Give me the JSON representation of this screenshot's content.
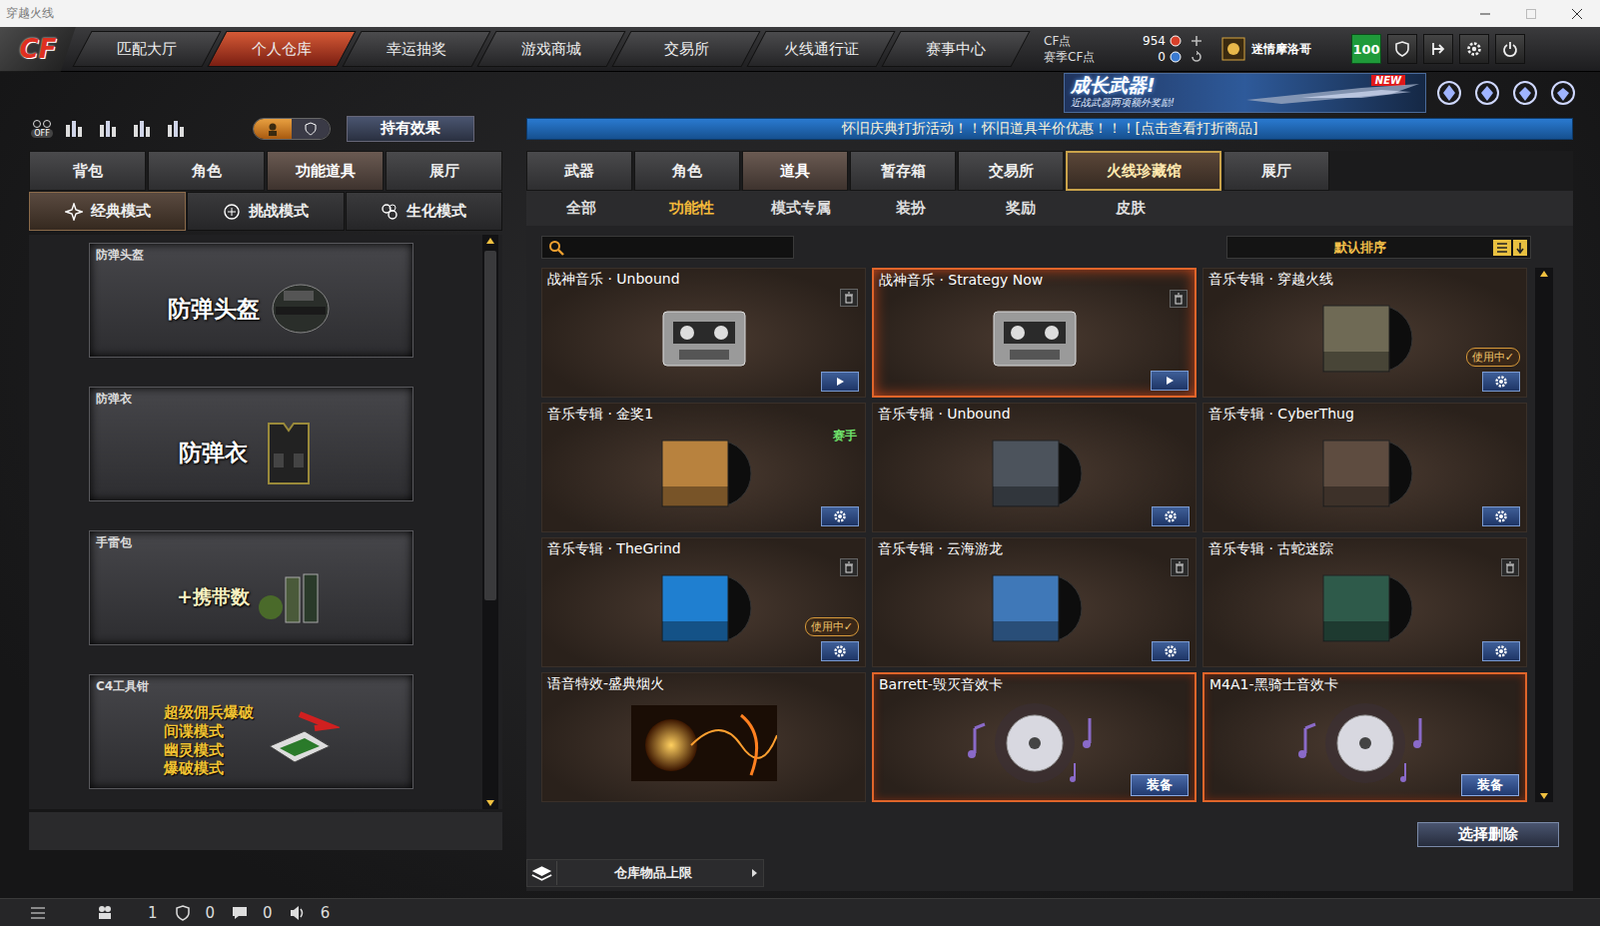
{
  "window": {
    "title": "穿越火线"
  },
  "nav": {
    "logo": "CF",
    "tabs": [
      {
        "label": "匹配大厅",
        "selected": false
      },
      {
        "label": "个人仓库",
        "selected": true
      },
      {
        "label": "幸运抽奖",
        "selected": false
      },
      {
        "label": "游戏商城",
        "selected": false
      },
      {
        "label": "交易所",
        "selected": false
      },
      {
        "label": "火线通行证",
        "selected": false
      },
      {
        "label": "赛事中心",
        "selected": false
      }
    ],
    "currency": [
      {
        "label": "CF点",
        "value": "954"
      },
      {
        "label": "赛季CF点",
        "value": "0"
      }
    ],
    "user": {
      "name": "迷情摩洛哥",
      "level": "100"
    }
  },
  "banner": {
    "title": "成长武器!",
    "subtitle": "近战武器两项额外奖励!",
    "badge": "NEW"
  },
  "announcement": "怀旧庆典打折活动！！怀旧道具半价优惠！！！[点击查看打折商品]",
  "left": {
    "toolbar": {
      "off_label": "OFF",
      "view_toggle": [
        {
          "selected": true
        },
        {
          "selected": false
        }
      ],
      "effect_button": "持有效果"
    },
    "tabs": [
      {
        "label": "背包",
        "selected": false
      },
      {
        "label": "角色",
        "selected": false
      },
      {
        "label": "功能道具",
        "selected": true
      },
      {
        "label": "展厅",
        "selected": false
      }
    ],
    "modes": [
      {
        "label": "经典模式",
        "selected": true
      },
      {
        "label": "挑战模式",
        "selected": false
      },
      {
        "label": "生化模式",
        "selected": false
      }
    ],
    "items": [
      {
        "label": "防弹头盔",
        "kind": "helmet",
        "captions": [
          "防弹头盔"
        ]
      },
      {
        "label": "防弹衣",
        "kind": "vest",
        "captions": [
          "防弹衣"
        ]
      },
      {
        "label": "手雷包",
        "kind": "grenade",
        "captions": [
          "+携带数"
        ]
      },
      {
        "label": "C4工具钳",
        "kind": "c4",
        "captions": [
          "超级佣兵爆破",
          "间谍模式",
          "幽灵模式",
          "爆破模式"
        ]
      }
    ]
  },
  "right": {
    "tabs": [
      {
        "label": "武器",
        "selected": false,
        "featured": false
      },
      {
        "label": "角色",
        "selected": false,
        "featured": false
      },
      {
        "label": "道具",
        "selected": true,
        "featured": false
      },
      {
        "label": "暂存箱",
        "selected": false,
        "featured": false
      },
      {
        "label": "交易所",
        "selected": false,
        "featured": false
      },
      {
        "label": "火线珍藏馆",
        "selected": false,
        "featured": true
      },
      {
        "label": "展厅",
        "selected": false,
        "featured": false
      }
    ],
    "subtabs": [
      {
        "label": "全部",
        "selected": false
      },
      {
        "label": "功能性",
        "selected": true
      },
      {
        "label": "模式专属",
        "selected": false
      },
      {
        "label": "装扮",
        "selected": false
      },
      {
        "label": "奖励",
        "selected": false
      },
      {
        "label": "皮肤",
        "selected": false
      }
    ],
    "search": {
      "value": ""
    },
    "sort": "默认排序",
    "items": [
      {
        "title": "战神音乐 · Unbound",
        "kind": "cassette",
        "selected": false,
        "highlighted": false,
        "deletable": true,
        "playable": true,
        "settings": false
      },
      {
        "title": "战神音乐 · Strategy Now",
        "kind": "cassette",
        "selected": true,
        "highlighted": true,
        "deletable": true,
        "playable": true,
        "settings": false
      },
      {
        "title": "音乐专辑 · 穿越火线",
        "kind": "album",
        "color": "#6f6a55",
        "selected": false,
        "highlighted": false,
        "deletable": false,
        "playable": false,
        "settings": true,
        "badge": "使用中✓"
      },
      {
        "title": "音乐专辑 · 金奖1",
        "kind": "album",
        "color": "#b8823e",
        "selected": false,
        "highlighted": false,
        "deletable": false,
        "playable": false,
        "settings": true,
        "tag": "赛手"
      },
      {
        "title": "音乐专辑 · Unbound",
        "kind": "album",
        "color": "#4c535c",
        "selected": false,
        "highlighted": false,
        "deletable": false,
        "playable": false,
        "settings": true
      },
      {
        "title": "音乐专辑 · CyberThug",
        "kind": "album",
        "color": "#5e4c40",
        "selected": false,
        "highlighted": false,
        "deletable": false,
        "playable": false,
        "settings": true
      },
      {
        "title": "音乐专辑 · TheGrind",
        "kind": "album",
        "color": "#1f7fd0",
        "selected": false,
        "highlighted": false,
        "deletable": true,
        "playable": false,
        "settings": true,
        "badge": "使用中✓"
      },
      {
        "title": "音乐专辑 · 云海游龙",
        "kind": "album",
        "color": "#3f78b8",
        "selected": false,
        "highlighted": false,
        "deletable": true,
        "playable": false,
        "settings": true
      },
      {
        "title": "音乐专辑 · 古蛇迷踪",
        "kind": "album",
        "color": "#2e5a4a",
        "selected": false,
        "highlighted": false,
        "deletable": true,
        "playable": false,
        "settings": true
      },
      {
        "title": "语音特效-盛典烟火",
        "kind": "effect",
        "selected": false,
        "highlighted": false,
        "deletable": false,
        "playable": false,
        "settings": false
      },
      {
        "title": "Barrett-毁灭音效卡",
        "kind": "soundcard",
        "selected": false,
        "highlighted": true,
        "deletable": false,
        "playable": false,
        "settings": false,
        "equip": "装备"
      },
      {
        "title": "M4A1-黑骑士音效卡",
        "kind": "soundcard",
        "selected": false,
        "highlighted": true,
        "deletable": false,
        "playable": false,
        "settings": false,
        "equip": "装备"
      }
    ],
    "delete_button": "选择删除",
    "capacity": "仓库物品上限"
  },
  "status_bar": [
    {
      "kind": "players",
      "value": "1"
    },
    {
      "kind": "shield",
      "value": "0"
    },
    {
      "kind": "chat",
      "value": "0"
    },
    {
      "kind": "sound",
      "value": "6"
    }
  ]
}
